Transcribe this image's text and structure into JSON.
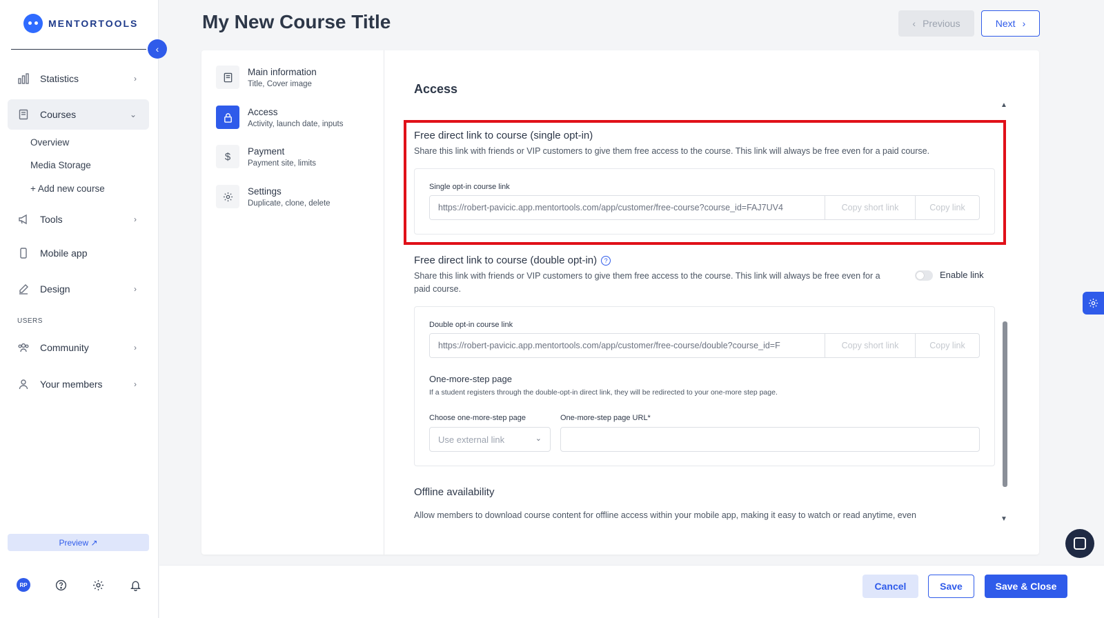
{
  "brand": {
    "name": "MENTORTOOLS",
    "accent": "#2f5bea"
  },
  "sidebar": {
    "items": [
      {
        "label": "Statistics",
        "icon": "bar-chart-icon"
      },
      {
        "label": "Courses",
        "icon": "book-icon",
        "active": true
      },
      {
        "label": "Tools",
        "icon": "megaphone-icon"
      },
      {
        "label": "Mobile app",
        "icon": "phone-icon"
      },
      {
        "label": "Design",
        "icon": "pencil-icon"
      },
      {
        "label": "Community",
        "icon": "people-icon"
      },
      {
        "label": "Your members",
        "icon": "user-icon"
      }
    ],
    "courses_sub": [
      "Overview",
      "Media Storage",
      "+ Add new course"
    ],
    "users_section": "USERS",
    "preview": "Preview ↗",
    "avatar_initials": "RP"
  },
  "header": {
    "title": "My New Course Title",
    "previous": "Previous",
    "next": "Next"
  },
  "steps": [
    {
      "title": "Main information",
      "sub": "Title, Cover image"
    },
    {
      "title": "Access",
      "sub": "Activity, launch date, inputs",
      "active": true
    },
    {
      "title": "Payment",
      "sub": "Payment site, limits"
    },
    {
      "title": "Settings",
      "sub": "Duplicate, clone, delete"
    }
  ],
  "access": {
    "title": "Access",
    "single": {
      "title": "Free direct link to course (single opt-in)",
      "desc": "Share this link with friends or VIP customers to give them free access to the course. This link will always be free even for a paid course.",
      "label": "Single opt-in course link",
      "value": "https://robert-pavicic.app.mentortools.com/app/customer/free-course?course_id=FAJ7UV4",
      "copy_short": "Copy short link",
      "copy": "Copy link"
    },
    "double": {
      "title": "Free direct link to course (double opt-in)",
      "desc": "Share this link with friends or VIP customers to give them free access to the course. This link will always be free even for a paid course.",
      "toggle_label": "Enable link",
      "label": "Double opt-in course link",
      "value": "https://robert-pavicic.app.mentortools.com/app/customer/free-course/double?course_id=F",
      "copy_short": "Copy short link",
      "copy": "Copy link",
      "one_more_title": "One-more-step page",
      "one_more_desc": "If a student registers through the double-opt-in direct link, they will be redirected to your one-more step page.",
      "choose_label": "Choose one-more-step page",
      "choose_value": "Use external link",
      "url_label": "One-more-step page URL*",
      "url_value": ""
    },
    "offline": {
      "title": "Offline availability",
      "desc": "Allow members to download course content for offline access within your mobile app, making it easy to watch or read anytime, even"
    }
  },
  "footer": {
    "cancel": "Cancel",
    "save": "Save",
    "save_close": "Save & Close"
  }
}
